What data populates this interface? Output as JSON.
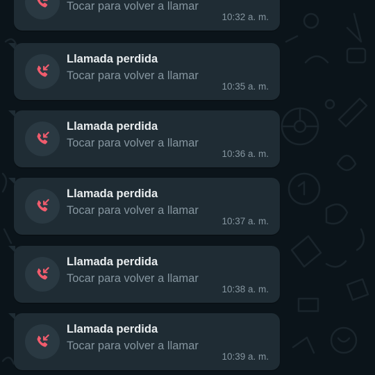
{
  "colors": {
    "background": "#0b141a",
    "bubble": "#1f2c34",
    "icon_circle": "#2a3942",
    "missed_call": "#f15c6d",
    "title_text": "#e9edef",
    "secondary_text": "#8696a0"
  },
  "messages": [
    {
      "title": "",
      "subtitle": "Tocar para volver a llamar",
      "time": "10:32 a. m.",
      "icon": "missed-call-icon"
    },
    {
      "title": "Llamada perdida",
      "subtitle": "Tocar para volver a llamar",
      "time": "10:35 a. m.",
      "icon": "missed-call-icon"
    },
    {
      "title": "Llamada perdida",
      "subtitle": "Tocar para volver a llamar",
      "time": "10:36 a. m.",
      "icon": "missed-call-icon"
    },
    {
      "title": "Llamada perdida",
      "subtitle": "Tocar para volver a llamar",
      "time": "10:37 a. m.",
      "icon": "missed-call-icon"
    },
    {
      "title": "Llamada perdida",
      "subtitle": "Tocar para volver a llamar",
      "time": "10:38 a. m.",
      "icon": "missed-call-icon"
    },
    {
      "title": "Llamada perdida",
      "subtitle": "Tocar para volver a llamar",
      "time": "10:39 a. m.",
      "icon": "missed-call-icon"
    }
  ]
}
